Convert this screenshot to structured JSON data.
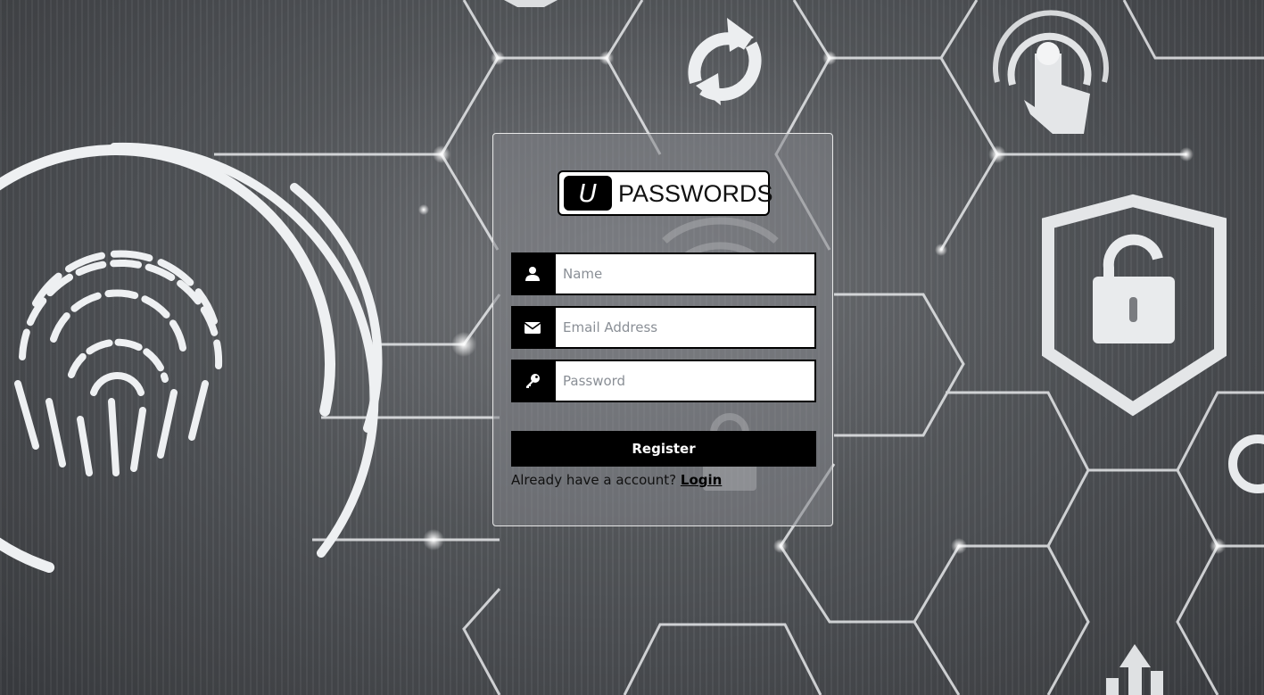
{
  "brand": {
    "logo_mark": "U",
    "logo_text": "PASSWORDS"
  },
  "form": {
    "name": {
      "placeholder": "Name",
      "value": "",
      "icon": "user-icon"
    },
    "email": {
      "placeholder": "Email Address",
      "value": "",
      "icon": "envelope-icon"
    },
    "password": {
      "placeholder": "Password",
      "value": "",
      "icon": "key-icon"
    },
    "register_label": "Register",
    "login_prompt": "Already have a account?",
    "login_link": "Login"
  },
  "background": {
    "decor_icons": [
      "fingerprint-icon",
      "refresh-icon",
      "touch-icon",
      "padlock-shield-icon",
      "wifi-icon",
      "lock-icon",
      "upload-icon"
    ]
  },
  "colors": {
    "button": "#000000",
    "input_border": "#000000",
    "card_border": "#e8e8e8"
  }
}
